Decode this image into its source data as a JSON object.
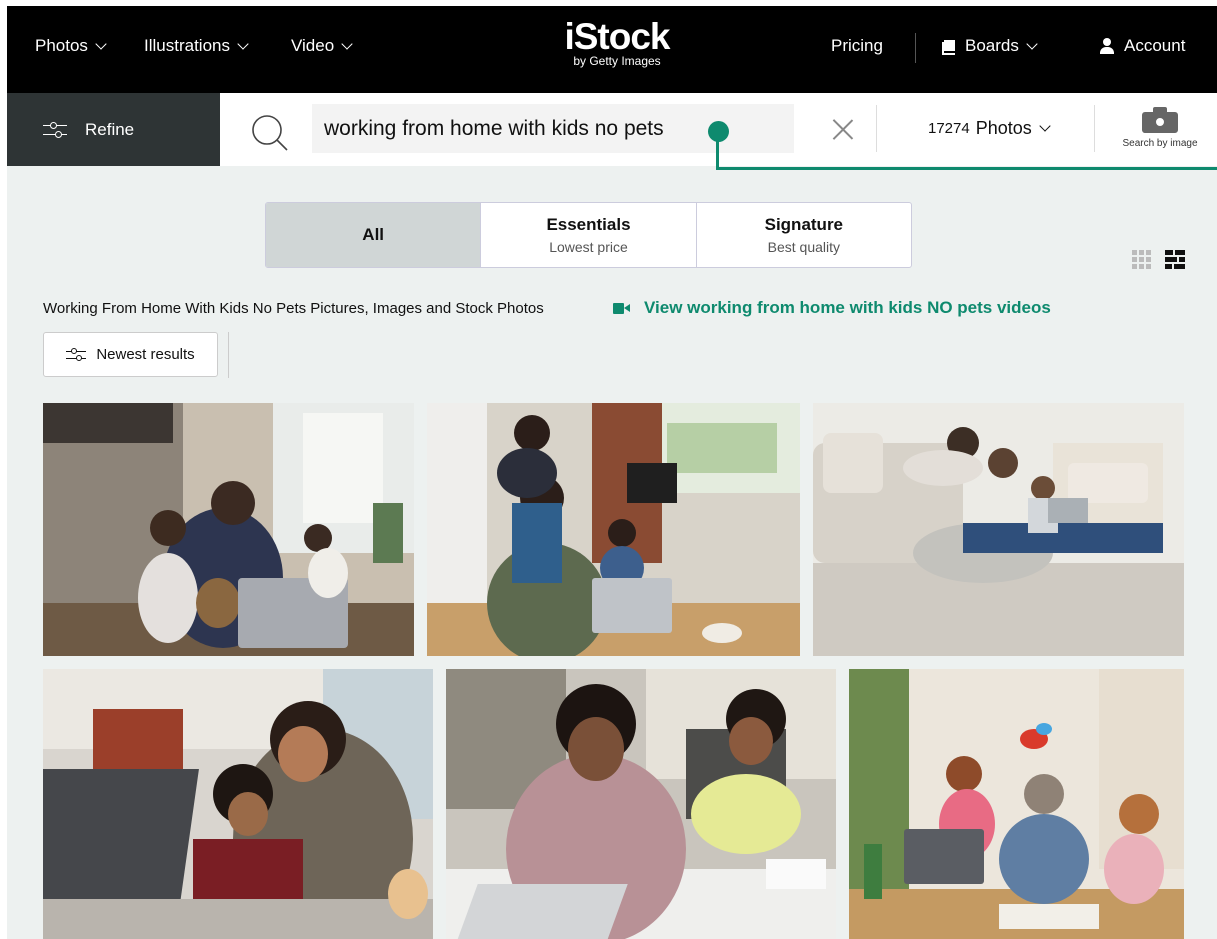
{
  "nav": {
    "photos": "Photos",
    "illustrations": "Illustrations",
    "video": "Video",
    "logo_main": "iStock",
    "logo_sub": "by Getty Images",
    "pricing": "Pricing",
    "boards": "Boards",
    "account": "Account"
  },
  "search": {
    "refine_label": "Refine",
    "query": "working from home with kids no pets",
    "result_count": "17274",
    "media_type": "Photos",
    "search_by_image": "Search by image"
  },
  "tabs": [
    {
      "title": "All",
      "subtitle": ""
    },
    {
      "title": "Essentials",
      "subtitle": "Lowest price"
    },
    {
      "title": "Signature",
      "subtitle": "Best quality"
    }
  ],
  "results": {
    "title": "Working From Home With Kids No Pets Pictures, Images and Stock Photos",
    "video_link": "View working from home with kids NO pets videos",
    "sort_label": "Newest results"
  },
  "colors": {
    "brand_green": "#0e8a6e",
    "nav_bg": "#000000",
    "refine_bg": "#2e3435",
    "page_bg": "#edf1f0"
  }
}
